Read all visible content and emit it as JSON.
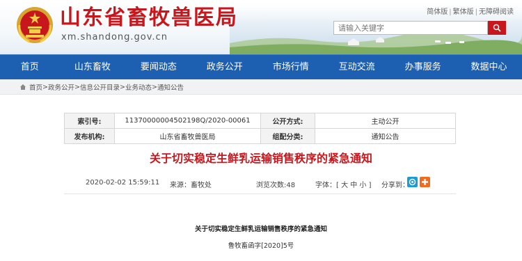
{
  "header": {
    "title": "山东省畜牧兽医局",
    "domain": "xm.shandong.gov.cn",
    "lang_links": [
      "简体版",
      "繁体版",
      "无障碍阅读"
    ],
    "search": {
      "placeholder": "请输入关键字"
    }
  },
  "nav": {
    "items": [
      "首页",
      "山东畜牧",
      "要闻动态",
      "政务公开",
      "市场行情",
      "互动交流",
      "办事服务",
      "数据中心"
    ]
  },
  "breadcrumb": {
    "items": [
      "首页",
      "政务公开",
      "信息公开目录",
      "业务动态",
      "通知公告"
    ],
    "separator": ">"
  },
  "info": {
    "index_label": "索引号:",
    "index_value": "11370000004502198Q/2020-00061",
    "public_label": "公开方式:",
    "public_value": "主动公开",
    "org_label": "发布机构:",
    "org_value": "山东省畜牧兽医局",
    "category_label": "组配分类:",
    "category_value": "通知公告"
  },
  "document": {
    "title": "关于切实稳定生鲜乳运输销售秩序的紧急通知",
    "date": "2020-02-02 15:59:11",
    "source": "来源：畜牧处",
    "views": "浏览次数:48",
    "font_size": "字体：[ 大 中 小 ]",
    "share_label": "分享到：",
    "body_title": "关于切实稳定生鲜乳运输销售秩序的紧急通知",
    "body_doc_no": "鲁牧畜函字[2020]5号"
  },
  "colors": {
    "brand_red": "#c8161d",
    "nav_blue": "#1d5fb0"
  }
}
